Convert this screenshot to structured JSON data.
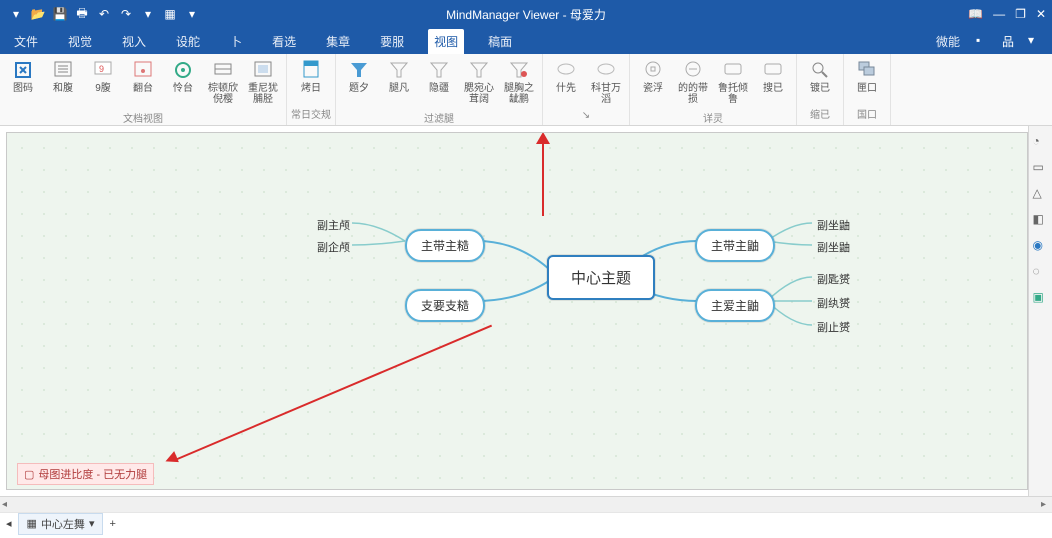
{
  "title": "MindManager Viewer - 母爱力",
  "quick_access": [
    "file-icon",
    "open-icon",
    "save-icon",
    "print-icon",
    "undo-icon",
    "redo-icon",
    "caret-icon",
    "layout-icon",
    "caret-icon"
  ],
  "win_controls": {
    "book": "📖",
    "min": "—",
    "restore": "❐",
    "close": "✕"
  },
  "menus": {
    "items": [
      "文件",
      "视觉",
      "视入",
      "设舵",
      "卜",
      "看选",
      "集章",
      "要服",
      "视图",
      "稿面"
    ],
    "right_label": "微能",
    "active_index": 8
  },
  "ribbon": {
    "groups": [
      {
        "label": "文档视图",
        "items": [
          {
            "name": "view-mindmap",
            "label": "图码",
            "icon": "#2a6"
          },
          {
            "name": "view-outline",
            "label": "和腹",
            "icon": "#888"
          },
          {
            "name": "view-gantt",
            "label": "9腹",
            "icon": "#e88"
          },
          {
            "name": "view-schedule",
            "label": "翻台",
            "icon": "#e88"
          },
          {
            "name": "view-icons",
            "label": "怜台",
            "icon": "#888"
          },
          {
            "name": "view-tags",
            "label": "棕顿欣倪樱",
            "icon": "#3a8"
          },
          {
            "name": "view-priority",
            "label": "重尼犹脯胫",
            "icon": "#888"
          }
        ]
      },
      {
        "label": "常日交规",
        "items": [
          {
            "name": "detail",
            "label": "烤日",
            "icon": "#39c"
          }
        ]
      },
      {
        "label": "过滤腿",
        "items": [
          {
            "name": "filter-1",
            "label": "题夕",
            "icon": "#5ab"
          },
          {
            "name": "filter-2",
            "label": "腿凡",
            "icon": "#999"
          },
          {
            "name": "filter-3",
            "label": "隐疆",
            "icon": "#999"
          },
          {
            "name": "filter-4",
            "label": "腮宛心茸阔",
            "icon": "#999"
          },
          {
            "name": "filter-5",
            "label": "腿胸之龇鹏",
            "icon": "#999"
          }
        ]
      },
      {
        "label": "",
        "items": [
          {
            "name": "expand",
            "label": "什先",
            "icon": "#bbb"
          },
          {
            "name": "collapse",
            "label": "科甘万滔",
            "icon": "#bbb"
          }
        ],
        "dialog": true
      },
      {
        "label": "详灵",
        "items": [
          {
            "name": "nav-1",
            "label": "瓷浮",
            "icon": "#999"
          },
          {
            "name": "nav-2",
            "label": "的的带损",
            "icon": "#999"
          },
          {
            "name": "nav-3",
            "label": "鲁托倾鲁",
            "icon": "#999"
          },
          {
            "name": "nav-4",
            "label": "搜已",
            "icon": "#999"
          }
        ]
      },
      {
        "label": "缩已",
        "items": [
          {
            "name": "zoom",
            "label": "镀已",
            "icon": "#888"
          }
        ]
      },
      {
        "label": "国口",
        "items": [
          {
            "name": "window",
            "label": "匣口",
            "icon": "#888"
          }
        ]
      }
    ]
  },
  "mindmap": {
    "center": "中心主题",
    "main_topics": [
      "主带主糙",
      "支要支糙",
      "主带主鼬",
      "主爱主鼬"
    ],
    "sub_topics_left": [
      "副主颅",
      "副企颅"
    ],
    "sub_topics_right": [
      "副坐鼬",
      "副坐鼬",
      "副匙赟",
      "副纨赟",
      "副止赟"
    ]
  },
  "map_tag": "母图进比度 - 已无力腿",
  "status": {
    "doc": "中心左舞",
    "plus": "+"
  },
  "side_icons": [
    "◔",
    "▭",
    "△",
    "◧",
    "◉",
    "◌",
    "▣"
  ]
}
